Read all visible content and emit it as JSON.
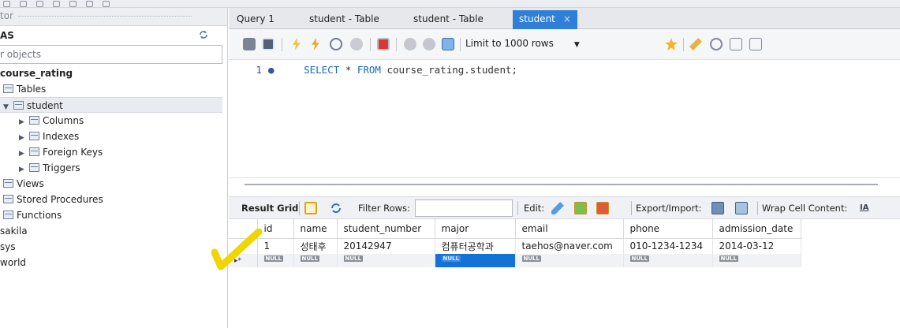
{
  "sidebar": {
    "header_label": "tor",
    "schemas_title": "AS",
    "filter_placeholder": "r objects",
    "tree": [
      {
        "label": "course_rating",
        "bold": true
      },
      {
        "label": "Tables"
      },
      {
        "label": "student"
      },
      {
        "label": "Columns"
      },
      {
        "label": "Indexes"
      },
      {
        "label": "Foreign Keys"
      },
      {
        "label": "Triggers"
      },
      {
        "label": "Views"
      },
      {
        "label": "Stored Procedures"
      },
      {
        "label": "Functions"
      },
      {
        "label": "sakila"
      },
      {
        "label": "sys"
      },
      {
        "label": "world"
      }
    ]
  },
  "tabs": [
    {
      "label": "Query 1"
    },
    {
      "label": "student - Table"
    },
    {
      "label": "student - Table"
    },
    {
      "label": "student",
      "close": "×"
    }
  ],
  "toolbar": {
    "limit_label": "Limit to 1000 rows",
    "icons": [
      "folder-icon",
      "save-icon",
      "lightning-icon",
      "lightning-cursor-icon",
      "magnifier-explain-icon",
      "stop-icon",
      "toggle-error-icon",
      "commit-icon",
      "rollback-icon",
      "autocommit-icon",
      "favorite-icon",
      "beautify-icon",
      "find-icon",
      "invisible-chars-icon",
      "wrap-icon"
    ]
  },
  "editor": {
    "line_number": "1",
    "bullet": "●",
    "kw_select": "SELECT",
    "star": "*",
    "kw_from": "FROM",
    "target": "course_rating.student;"
  },
  "result_toolbar": {
    "result_grid": "Result Grid",
    "filter_rows": "Filter Rows:",
    "edit": "Edit:",
    "export_import": "Export/Import:",
    "wrap_cell": "Wrap Cell Content:"
  },
  "grid": {
    "columns": [
      "id",
      "name",
      "student_number",
      "major",
      "email",
      "phone",
      "admission_date"
    ],
    "rows": [
      [
        "1",
        "성태후",
        "20142947",
        "컴퓨터공학과",
        "taehos@naver.com",
        "010-1234-1234",
        "2014-03-12"
      ]
    ],
    "new_row_marker": "▸*",
    "null_label": "NULL"
  },
  "colors": {
    "active_tab": "#2f7ed8",
    "selected_cell": "#1471d8",
    "keyword": "#1a6ac9",
    "checkmark": "#f0d500"
  }
}
